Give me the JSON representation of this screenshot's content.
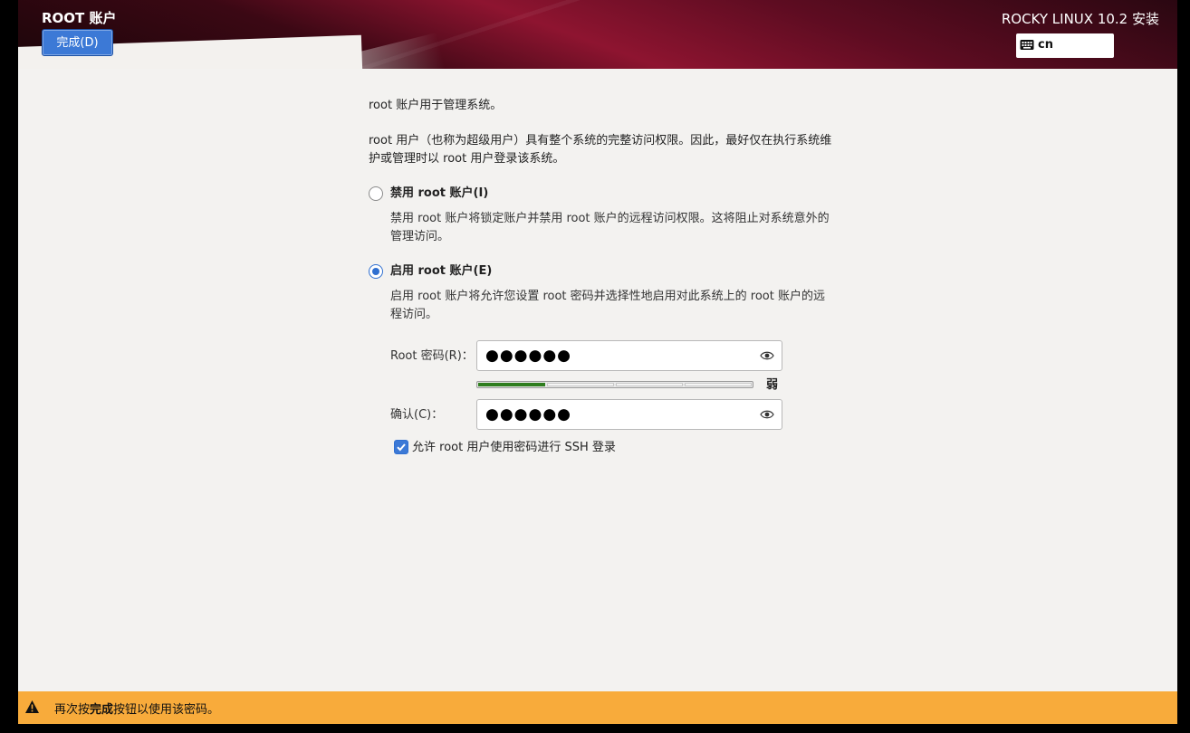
{
  "header": {
    "page_title": "ROOT 账户",
    "done_button": "完成(D)",
    "product_title": "ROCKY LINUX 10.2 安装",
    "keyboard_layout": "cn",
    "keyboard_icon": "keyboard-icon"
  },
  "main": {
    "intro": "root 账户用于管理系统。",
    "explanation": "root 用户（也称为超级用户）具有整个系统的完整访问权限。因此，最好仅在执行系统维护或管理时以 root 用户登录该系统。",
    "disable_option": {
      "label": "禁用 root 账户(I)",
      "description": "禁用 root 账户将锁定账户并禁用 root 账户的远程访问权限。这将阻止对系统意外的管理访问。",
      "selected": false
    },
    "enable_option": {
      "label": "启用 root 账户(E)",
      "description": "启用 root 账户将允许您设置 root 密码并选择性地启用对此系统上的 root 账户的远程访问。",
      "selected": true
    },
    "password": {
      "label": "Root 密码(R)：",
      "value": "●●●●●●",
      "icon": "eye-icon"
    },
    "strength": {
      "label": "弱",
      "level": 0.25,
      "color": "#2e7d1e"
    },
    "confirm": {
      "label": "确认(C)：",
      "value": "●●●●●●",
      "icon": "eye-icon"
    },
    "ssh_checkbox": {
      "label": "允许 root 用户使用密码进行 SSH 登录",
      "checked": true
    }
  },
  "status_bar": {
    "icon": "warning-icon",
    "text_before": "再次按",
    "text_bold": "完成",
    "text_after": "按钮以使用该密码。",
    "color": "#f8ab3b"
  },
  "colors": {
    "accent": "#3c79d6",
    "header": "#8e1430",
    "background": "#f3f2f0"
  }
}
